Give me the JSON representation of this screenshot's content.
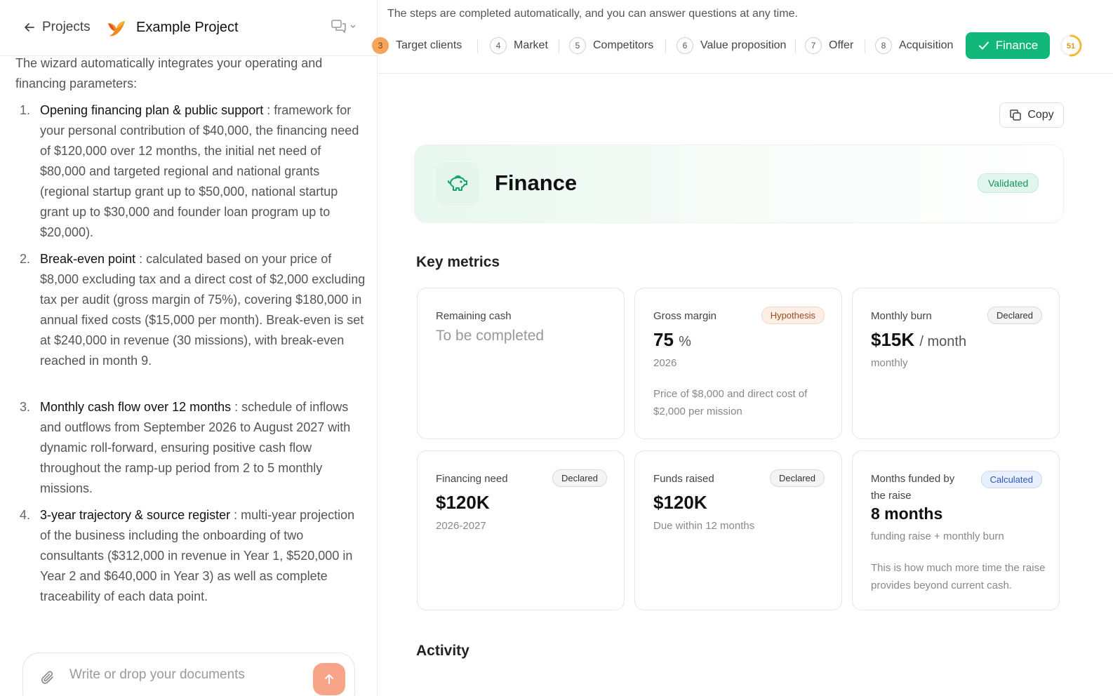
{
  "header": {
    "back_label": "Projects",
    "project_title": "Example Project"
  },
  "message": {
    "intro": "The wizard automatically integrates your operating and financing parameters:",
    "items": [
      {
        "num": "1.",
        "title": "Opening financing plan & public support",
        "sep": " : ",
        "body": "framework for your personal contribution of $40,000, the financing need of $120,000 over 12 months, the initial net need of $80,000 and targeted regional and national grants (regional startup grant up to $50,000, national startup grant up to $30,000 and founder loan program up to $20,000)."
      },
      {
        "num": "2.",
        "title": "Break-even point",
        "sep": " : ",
        "body": "calculated based on your price of $8,000 excluding tax and a direct cost of $2,000 excluding tax per audit (gross margin of 75%), covering $180,000 in annual fixed costs ($15,000 per month). Break-even is set at $240,000 in revenue (30 missions), with break-even reached in month 9."
      },
      {
        "num": "3.",
        "title": "Monthly cash flow over 12 months",
        "sep": " : ",
        "body": "schedule of inflows and outflows from September 2026 to August 2027 with dynamic roll-forward, ensuring positive cash flow throughout the ramp-up period from 2 to 5 monthly missions."
      },
      {
        "num": "4.",
        "title": "3-year trajectory & source register",
        "sep": " : ",
        "body": "multi-year projection of the business including the onboarding of two consultants ($312,000 in revenue in Year 1, $520,000 in Year 2 and $640,000 in Year 3) as well as complete traceability of each data point."
      }
    ]
  },
  "composer": {
    "placeholder": "Write or drop your documents"
  },
  "top_info": "The steps are completed automatically, and you can answer questions at any time.",
  "steps": [
    {
      "num": "3",
      "label": "Target clients"
    },
    {
      "num": "4",
      "label": "Market"
    },
    {
      "num": "5",
      "label": "Competitors"
    },
    {
      "num": "6",
      "label": "Value proposition"
    },
    {
      "num": "7",
      "label": "Offer"
    },
    {
      "num": "8",
      "label": "Acquisition"
    }
  ],
  "active_step": "Finance",
  "progress": {
    "value": "51",
    "percent": 51
  },
  "copy_label": "Copy",
  "hero": {
    "title": "Finance",
    "status": "Validated"
  },
  "key_metrics": {
    "title": "Key metrics",
    "cards": [
      {
        "label": "Remaining cash",
        "value": "To be completed"
      },
      {
        "label": "Gross margin",
        "badge": "Hypothesis",
        "value": "75",
        "unit": "%",
        "sub": "2026",
        "note": "Price of $8,000 and direct cost of $2,000 per mission"
      },
      {
        "label": "Monthly burn",
        "badge": "Declared",
        "value": "$15K",
        "unit": "/ month",
        "sub": "monthly"
      },
      {
        "label": "Financing need",
        "badge": "Declared",
        "value": "$120K",
        "sub": "2026-2027"
      },
      {
        "label": "Funds raised",
        "badge": "Declared",
        "value": "$120K",
        "sub": "Due within 12 months"
      },
      {
        "label": "Months funded by the raise",
        "badge": "Calculated",
        "value": "8 months",
        "sub": "funding raise + monthly burn",
        "note": "This is how much more time the raise provides beyond current cash."
      }
    ]
  },
  "activity": {
    "title": "Activity"
  },
  "colors": {
    "accent": "#12b77a",
    "orange": "#f6a35c",
    "send": "#f7a488"
  }
}
